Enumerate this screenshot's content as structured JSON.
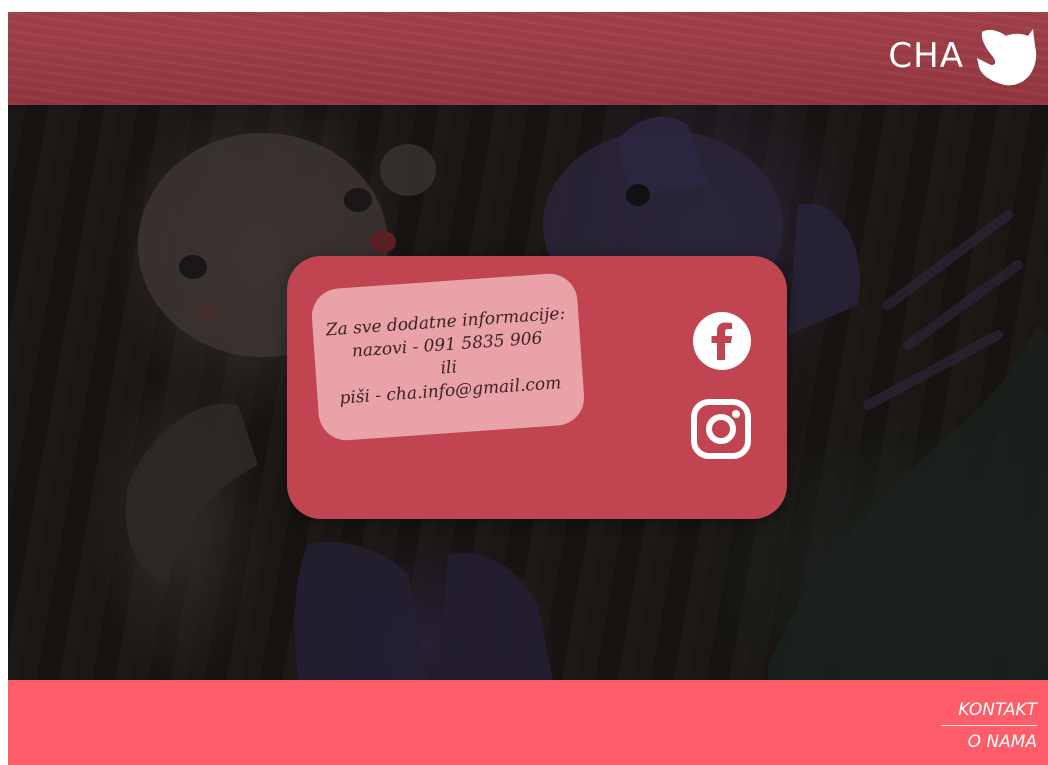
{
  "header": {
    "brand_text": "CHA",
    "brand_logo": "cat-head-logo"
  },
  "contact": {
    "lines": [
      "Za sve dodatne informacije:",
      "nazovi - 091 5835 906",
      "ili",
      "piši - cha.info@gmail.com"
    ],
    "social_icons": [
      "facebook-icon",
      "instagram-icon"
    ]
  },
  "footer": {
    "links": [
      "KONTAKT",
      "O NAMA"
    ]
  },
  "colors": {
    "header": "#9b3b44",
    "card": "#c04551",
    "info_box": "#e9a3a8",
    "footer": "#ff5d6a",
    "text_light": "#ffffff"
  }
}
